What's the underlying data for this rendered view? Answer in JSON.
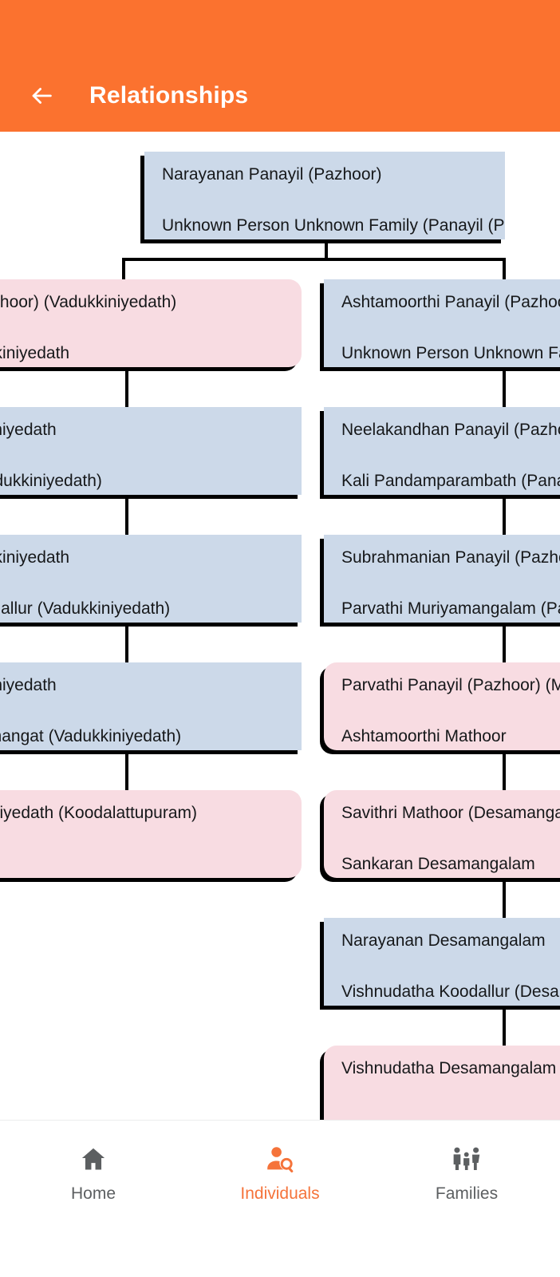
{
  "appbar": {
    "title": "Relationships",
    "back_icon": "arrow-left-icon",
    "background_color": "#fb722f",
    "title_color": "#ffffff"
  },
  "colors": {
    "card_blue": "#ccd9e9",
    "card_pink": "#f8dce2",
    "shadow": "#000000",
    "accent_orange": "#f5733a",
    "nav_inactive": "#5c5f61"
  },
  "tree": {
    "root": {
      "line1": "Narayanan Panayil (Pazhoor)",
      "line2": "Unknown Person Unknown Family (Panayil (Pazhoor))",
      "color": "blue"
    },
    "left_column": [
      {
        "line1": "Panayil (Pazhoor) (Vadukkiniyedath)",
        "line2": "anan Vadukkiniyedath",
        "color": "pink"
      },
      {
        "line1": "ran Vadukkiniyedath",
        "line2": "Chittoor (Vadukkiniyedath)",
        "color": "blue"
      },
      {
        "line1": "anan Vadukkiniyedath",
        "line2": "udatha Koodallur (Vadukkiniyedath)",
        "color": "blue"
      },
      {
        "line1": "ran Vadukkiniyedath",
        "line2": "atha Chemmangat (Vadukkiniyedath)",
        "color": "blue"
      },
      {
        "line1": "evi Vadukkiniyedath (Koodalattupuram)",
        "line2": "",
        "color": "pink"
      }
    ],
    "right_column": [
      {
        "line1": "Ashtamoorthi Panayil (Pazhoor)",
        "line2": "Unknown Person Unknown Family (Panay",
        "color": "blue"
      },
      {
        "line1": "Neelakandhan Panayil (Pazhoor)",
        "line2": "Kali Pandamparambath (Panayil (Pazho",
        "color": "blue"
      },
      {
        "line1": "Subrahmanian Panayil (Pazhoor)",
        "line2": "Parvathi Muriyamangalam (Panayil (Pa",
        "color": "blue"
      },
      {
        "line1": "Parvathi Panayil (Pazhoor) (Mathoor)",
        "line2": "Ashtamoorthi Mathoor",
        "color": "pink"
      },
      {
        "line1": "Savithri Mathoor (Desamangalam)",
        "line2": "Sankaran Desamangalam",
        "color": "pink"
      },
      {
        "line1": "Narayanan Desamangalam",
        "line2": "Vishnudatha Koodallur (Desamangalam)",
        "color": "blue"
      },
      {
        "line1": "Vishnudatha Desamangalam",
        "line2": "",
        "color": "pink"
      }
    ]
  },
  "bottomnav": {
    "items": [
      {
        "label": "Home",
        "icon": "home-icon",
        "active": false
      },
      {
        "label": "Individuals",
        "icon": "person-search-icon",
        "active": true
      },
      {
        "label": "Families",
        "icon": "family-icon",
        "active": false
      }
    ]
  }
}
